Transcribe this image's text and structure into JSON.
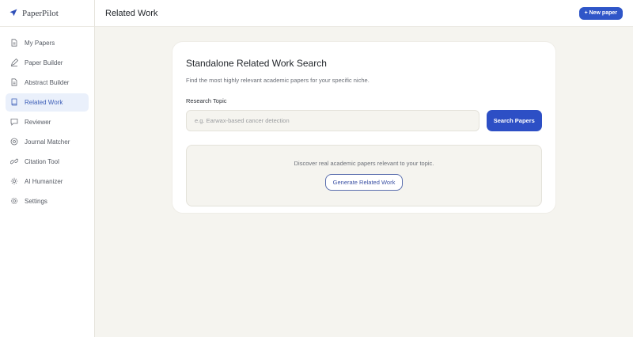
{
  "brand": {
    "name": "PaperPilot",
    "icon": "paper-plane-icon"
  },
  "sidebar": {
    "items": [
      {
        "label": "My Papers",
        "icon": "document-icon",
        "active": false
      },
      {
        "label": "Paper Builder",
        "icon": "pen-icon",
        "active": false
      },
      {
        "label": "Abstract Builder",
        "icon": "document-icon",
        "active": false
      },
      {
        "label": "Related Work",
        "icon": "book-icon",
        "active": true
      },
      {
        "label": "Reviewer",
        "icon": "chat-bubble-icon",
        "active": false
      },
      {
        "label": "Journal Matcher",
        "icon": "target-icon",
        "active": false
      },
      {
        "label": "Citation Tool",
        "icon": "link-icon",
        "active": false
      },
      {
        "label": "AI Humanizer",
        "icon": "sparkle-gear-icon",
        "active": false
      },
      {
        "label": "Settings",
        "icon": "gear-icon",
        "active": false
      }
    ]
  },
  "header": {
    "title": "Related Work",
    "new_paper_label": "+ New paper"
  },
  "search_card": {
    "title": "Standalone Related Work Search",
    "subtitle": "Find the most highly relevant academic papers for your specific niche.",
    "topic_label": "Research Topic",
    "topic_placeholder": "e.g. Earwax-based cancer detection",
    "topic_value": "",
    "search_button_label": "Search Papers"
  },
  "discover": {
    "text": "Discover real academic papers relevant to your topic.",
    "generate_button_label": "Generate Related Work"
  },
  "colors": {
    "accent": "#2d4fc5",
    "active_nav_bg": "#eaf0fb",
    "page_bg": "#f5f4ef"
  }
}
